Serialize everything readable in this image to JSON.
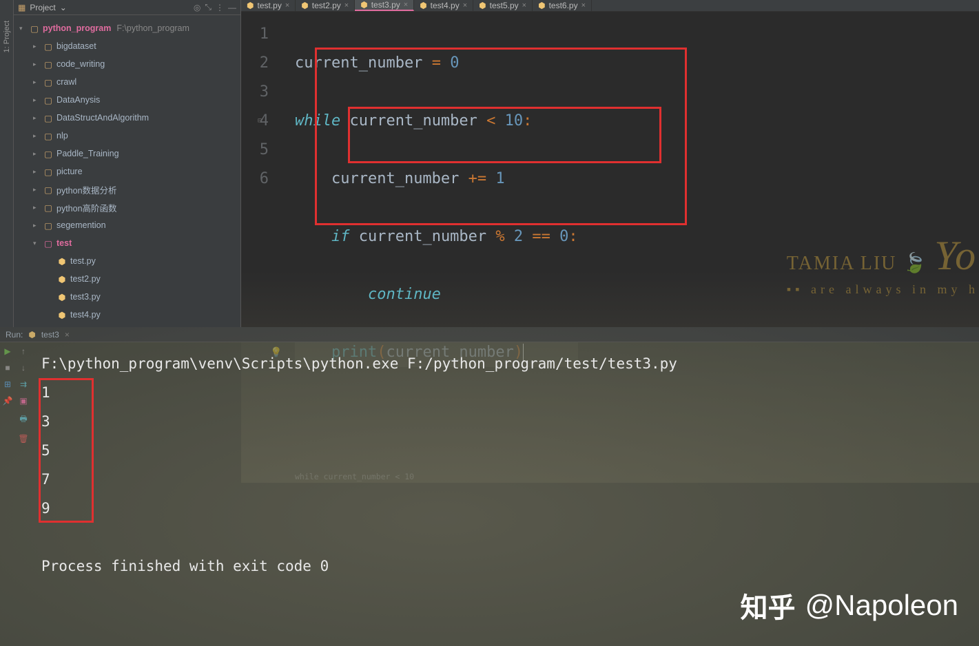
{
  "sidebar_vertical": "1: Project",
  "project_header": {
    "label": "Project"
  },
  "tree": {
    "root_name": "python_program",
    "root_path": "F:\\python_program",
    "folders": [
      "bigdataset",
      "code_writing",
      "crawl",
      "DataAnysis",
      "DataStructAndAlgorithm",
      "nlp",
      "Paddle_Training",
      "picture",
      "python数据分析",
      "python高阶函数",
      "segemention"
    ],
    "test_folder": "test",
    "test_files": [
      "test.py",
      "test2.py",
      "test3.py",
      "test4.py"
    ]
  },
  "tabs": [
    {
      "label": "test.py"
    },
    {
      "label": "test2.py"
    },
    {
      "label": "test3.py",
      "active": true
    },
    {
      "label": "test4.py"
    },
    {
      "label": "test5.py"
    },
    {
      "label": "test6.py"
    }
  ],
  "line_numbers": [
    "1",
    "2",
    "3",
    "4",
    "5",
    "6"
  ],
  "code": {
    "l1": "current_number = 0",
    "l2": "while current_number < 10:",
    "l3": "    current_number += 1",
    "l4": "    if current_number % 2 == 0:",
    "l5": "        continue",
    "l6": "    print(current_number)"
  },
  "breadcrumb": "while current_number < 10",
  "run": {
    "header_label": "Run:",
    "tab_label": "test3",
    "command": "F:\\python_program\\venv\\Scripts\\python.exe F:/python_program/test/test3.py",
    "output": [
      "1",
      "3",
      "5",
      "7",
      "9"
    ],
    "exit": "Process finished with exit code 0"
  },
  "watermark": {
    "name": "TAMIA LIU",
    "script": "Yo",
    "sub": "are always in my h"
  },
  "zhihu": {
    "logo": "知乎",
    "author": "@Napoleon"
  }
}
